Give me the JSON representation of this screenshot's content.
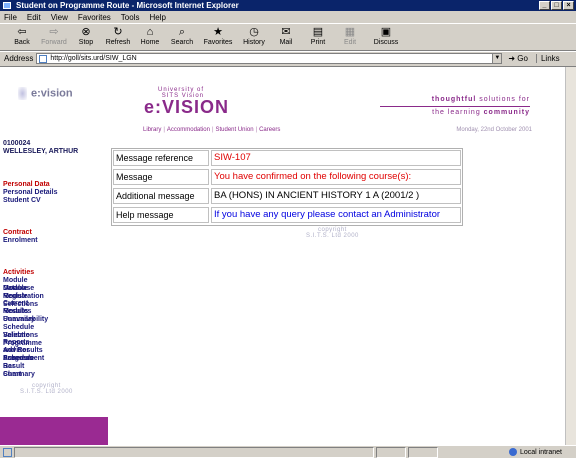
{
  "window": {
    "title": "Student on Programme Route - Microsoft Internet Explorer",
    "controls": [
      "_",
      "□",
      "×"
    ]
  },
  "menu": [
    "File",
    "Edit",
    "View",
    "Favorites",
    "Tools",
    "Help"
  ],
  "toolbar": [
    {
      "label": "Back",
      "icon": "back-arrow-icon",
      "glyph": "⇦",
      "enabled": true
    },
    {
      "label": "Forward",
      "icon": "forward-arrow-icon",
      "glyph": "⇨",
      "enabled": false
    },
    {
      "label": "Stop",
      "icon": "stop-icon",
      "glyph": "⊗",
      "enabled": true
    },
    {
      "label": "Refresh",
      "icon": "refresh-icon",
      "glyph": "↻",
      "enabled": true
    },
    {
      "label": "Home",
      "icon": "home-icon",
      "glyph": "⌂",
      "enabled": true
    },
    {
      "label": "Search",
      "icon": "search-icon",
      "glyph": "⌕",
      "enabled": true
    },
    {
      "label": "Favorites",
      "icon": "favorites-icon",
      "glyph": "★",
      "enabled": true
    },
    {
      "label": "History",
      "icon": "history-icon",
      "glyph": "◷",
      "enabled": true
    },
    {
      "label": "Mail",
      "icon": "mail-icon",
      "glyph": "✉",
      "enabled": true
    },
    {
      "label": "Print",
      "icon": "print-icon",
      "glyph": "▤",
      "enabled": true
    },
    {
      "label": "Edit",
      "icon": "edit-icon",
      "glyph": "▦",
      "enabled": false
    },
    {
      "label": "Discuss",
      "icon": "discuss-icon",
      "glyph": "▣",
      "enabled": true
    }
  ],
  "address": {
    "label": "Address",
    "url": "http://goll/sits.urd/SIW_LGN",
    "go_label": "Go",
    "links_label": "Links"
  },
  "sidebar": {
    "logo_text": "e:vision",
    "student_id": "0100024",
    "student_name": "WELLESLEY, ARTHUR",
    "personal_head": "Personal Data",
    "personal_items": [
      "Personal Details",
      "Student CV"
    ],
    "contract_head": "Contract",
    "contract_items": [
      "Enrolment"
    ],
    "activities_head": "Activities",
    "activities_items": [
      "Module Database",
      "Module Registration",
      "Module Selections",
      "Current Modules",
      "Results Summary",
      "Unavailability",
      "Schedule Selections",
      "Validate Programme",
      "Reports Advisor Progress",
      "and Results Assessment",
      "Schedule Result Summary",
      "Bar Chart"
    ],
    "copyright_line1": "copyright",
    "copyright_line2": "S.I.T.S. Ltd 2000"
  },
  "brand": {
    "uni_line1": "University of",
    "uni_line2": "SITS Vision",
    "name": "e:VISION",
    "tagline_top_normal": "thoughtful",
    "tagline_top_rest": " solutions for",
    "tagline_bottom_normal": "the learning ",
    "tagline_bottom_bold": "community",
    "nav_links": [
      "Library",
      "Accommodation",
      "Student Union",
      "Careers"
    ],
    "date": "Monday, 22nd October 2001"
  },
  "messages": [
    {
      "key": "Message reference",
      "value": "SIW-107",
      "color": "#e00000"
    },
    {
      "key": "Message",
      "value": "You have confirmed on the following course(s):",
      "color": "#e00000"
    },
    {
      "key": "Additional message",
      "value": "BA (HONS) IN ANCIENT HISTORY 1 A (2001/2 )",
      "color": "#000000"
    },
    {
      "key": "Help message",
      "value": "If you have any query please contact an Administrator",
      "color": "#0000e0"
    }
  ],
  "main_copyright_line1": "copyright",
  "main_copyright_line2": "S.I.T.S. Ltd 2000",
  "status": {
    "zone": "Local intranet"
  },
  "colors": {
    "brand_purple": "#8a2a8a",
    "sidebar_purple_block": "#9a2a92",
    "section_red": "#c00000",
    "link_navy": "#1a1a7a"
  }
}
